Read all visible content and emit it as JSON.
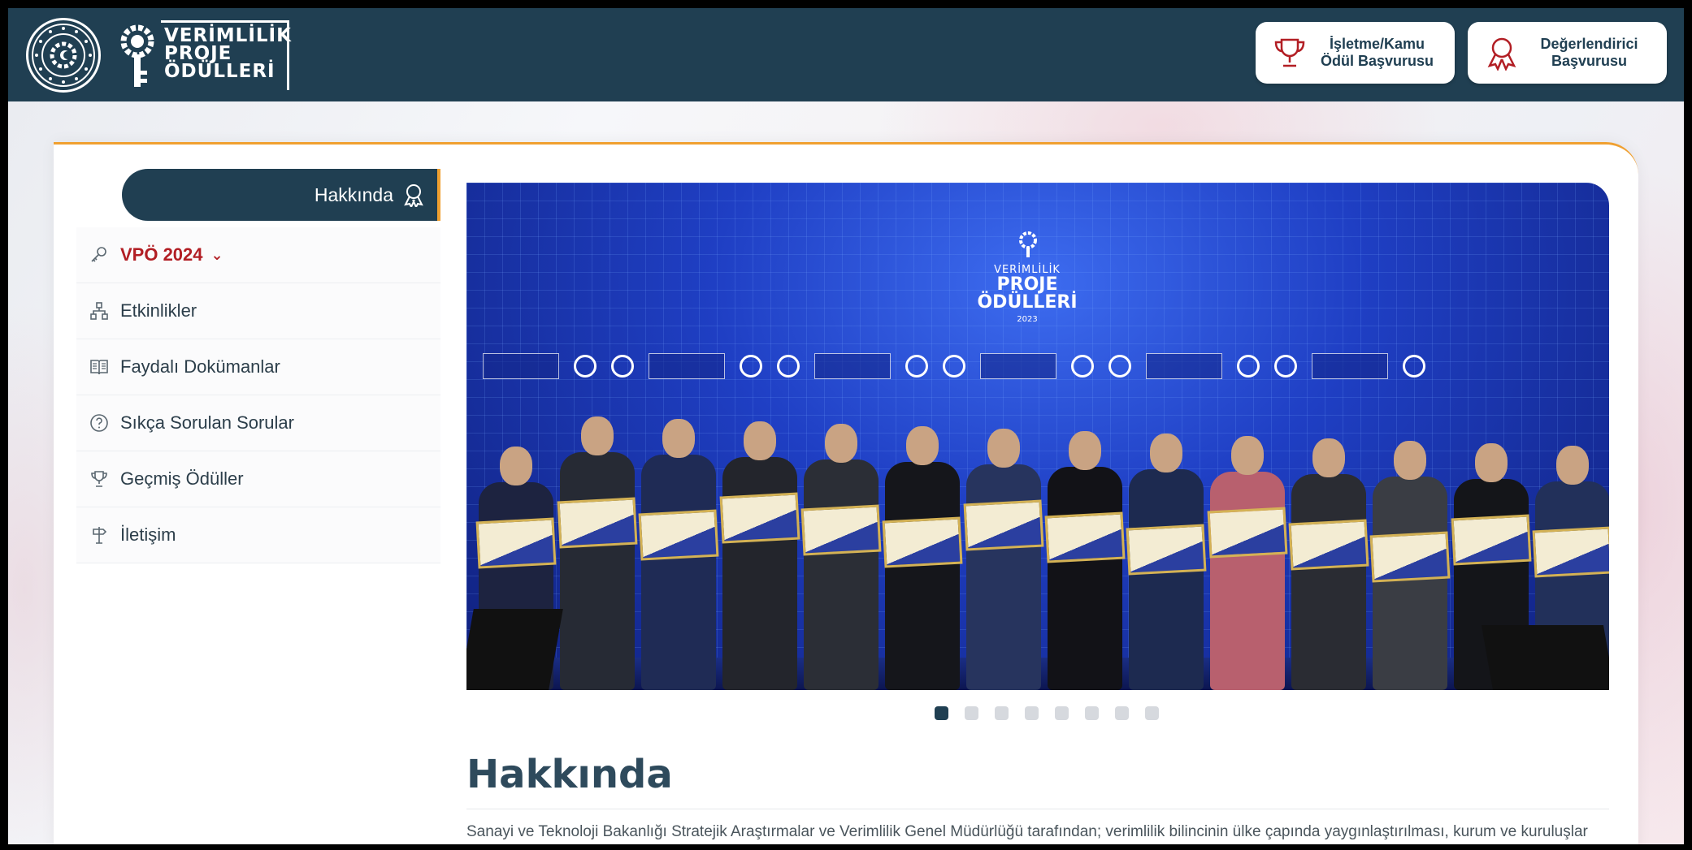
{
  "header": {
    "logo_lines": [
      "VERİMLİLİK",
      "PROJE",
      "ÖDÜLLERİ"
    ],
    "award_button": "İşletme/Kamu\nÖdül Başvurusu",
    "evaluator_button": "Değerlendirici\nBaşvurusu"
  },
  "sidebar": {
    "active_item": "Hakkında",
    "items": [
      {
        "label": "VPÖ 2024",
        "icon": "key-icon"
      },
      {
        "label": "Etkinlikler",
        "icon": "sitemap-icon"
      },
      {
        "label": "Faydalı Dokümanlar",
        "icon": "book-icon"
      },
      {
        "label": "Sıkça Sorulan Sorular",
        "icon": "question-icon"
      },
      {
        "label": "Geçmiş Ödüller",
        "icon": "trophy-icon"
      },
      {
        "label": "İletişim",
        "icon": "signpost-icon"
      }
    ]
  },
  "carousel": {
    "logo_top": "VERİMLİLİK",
    "logo_main": "PROJE ÖDÜLLERİ",
    "logo_year": "2023",
    "slide_count": 8,
    "active_slide": 1
  },
  "main": {
    "title": "Hakkında",
    "text": "Sanayi ve Teknoloji Bakanlığı Stratejik Araştırmalar ve Verimlilik Genel Müdürlüğü tarafından; verimlilik bilincinin ülke çapında yaygınlaştırılması, kurum ve kuruluşlar arasında bilgi ve tecrübe paylaşımın artırılması, verimlilik konusunda yürütülen projelerin kamuoyuna duyurulması, uygulanan projelerin sağladığı"
  },
  "colors": {
    "header_bg": "#203f52",
    "accent": "#f0a030",
    "vpo_red": "#b21e24"
  }
}
